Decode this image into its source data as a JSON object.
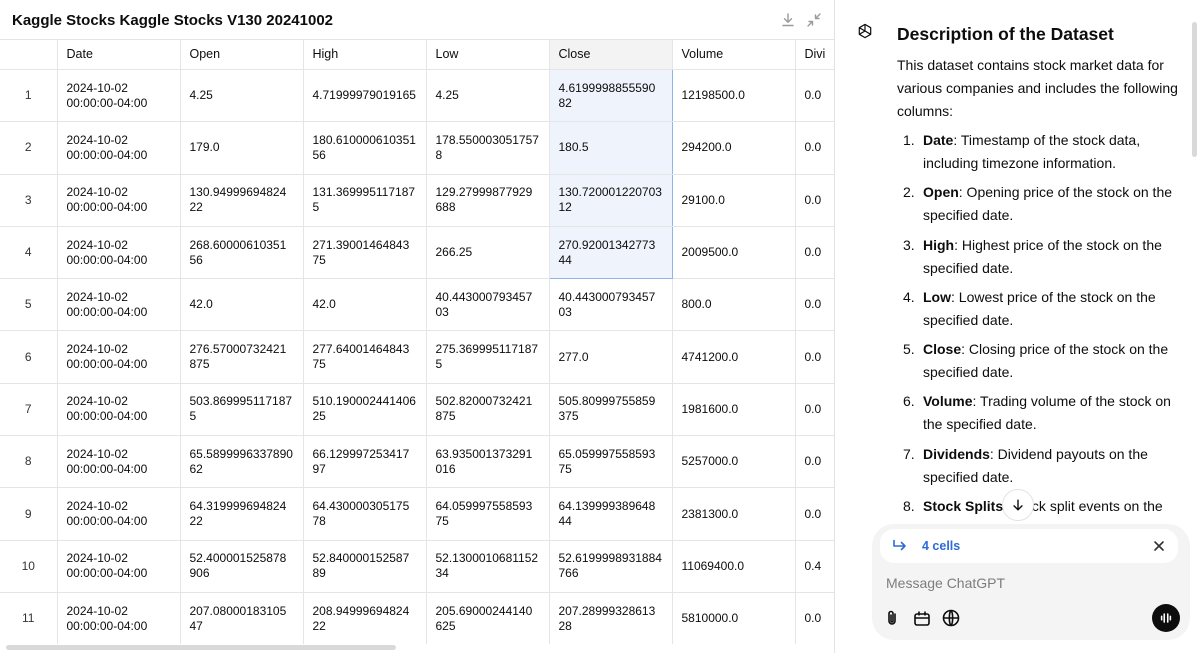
{
  "header": {
    "title": "Kaggle Stocks Kaggle Stocks V130 20241002"
  },
  "table": {
    "columns": [
      "Date",
      "Open",
      "High",
      "Low",
      "Close",
      "Volume",
      "Divi"
    ],
    "rows": [
      [
        "1",
        "2024-10-02\n00:00:00-04:00",
        "4.25",
        "4.71999979019165",
        "4.25",
        "4.6199998855590\n82",
        "12198500.0",
        "0.0"
      ],
      [
        "2",
        "2024-10-02\n00:00:00-04:00",
        "179.0",
        "180.610000610351\n56",
        "178.550003051757\n8",
        "180.5",
        "294200.0",
        "0.0"
      ],
      [
        "3",
        "2024-10-02\n00:00:00-04:00",
        "130.94999694824\n22",
        "131.369995117187\n5",
        "129.27999877929\n688",
        "130.720001220703\n12",
        "29100.0",
        "0.0"
      ],
      [
        "4",
        "2024-10-02\n00:00:00-04:00",
        "268.60000610351\n56",
        "271.39001464843\n75",
        "266.25",
        "270.92001342773\n44",
        "2009500.0",
        "0.0"
      ],
      [
        "5",
        "2024-10-02\n00:00:00-04:00",
        "42.0",
        "42.0",
        "40.443000793457\n03",
        "40.443000793457\n03",
        "800.0",
        "0.0"
      ],
      [
        "6",
        "2024-10-02\n00:00:00-04:00",
        "276.57000732421\n875",
        "277.64001464843\n75",
        "275.369995117187\n5",
        "277.0",
        "4741200.0",
        "0.0"
      ],
      [
        "7",
        "2024-10-02\n00:00:00-04:00",
        "503.869995117187\n5",
        "510.190002441406\n25",
        "502.82000732421\n875",
        "505.80999755859\n375",
        "1981600.0",
        "0.0"
      ],
      [
        "8",
        "2024-10-02\n00:00:00-04:00",
        "65.5899996337890\n62",
        "66.129997253417\n97",
        "63.935001373291\n016",
        "65.059997558593\n75",
        "5257000.0",
        "0.0"
      ],
      [
        "9",
        "2024-10-02\n00:00:00-04:00",
        "64.319999694824\n22",
        "64.430000305175\n78",
        "64.059997558593\n75",
        "64.139999389648\n44",
        "2381300.0",
        "0.0"
      ],
      [
        "10",
        "2024-10-02\n00:00:00-04:00",
        "52.400001525878\n906",
        "52.840000152587\n89",
        "52.1300010681152\n34",
        "52.6199998931884\n766",
        "11069400.0",
        "0.4"
      ],
      [
        "11",
        "2024-10-02\n00:00:00-04:00",
        "207.08000183105\n47",
        "208.94999694824\n22",
        "205.69000244140\n625",
        "207.28999328613\n28",
        "5810000.0",
        "0.0"
      ]
    ],
    "selected_column": "Close",
    "selected_rows": [
      1,
      2,
      3,
      4
    ]
  },
  "assistant": {
    "heading": "Description of the Dataset",
    "intro": "This dataset contains stock market data for various companies and includes the following columns:",
    "items": [
      {
        "num": "1.",
        "term": "Date",
        "desc": ": Timestamp of the stock data, including timezone information."
      },
      {
        "num": "2.",
        "term": "Open",
        "desc": ": Opening price of the stock on the specified date."
      },
      {
        "num": "3.",
        "term": "High",
        "desc": ": Highest price of the stock on the specified date."
      },
      {
        "num": "4.",
        "term": "Low",
        "desc": ": Lowest price of the stock on the specified date."
      },
      {
        "num": "5.",
        "term": "Close",
        "desc": ": Closing price of the stock on the specified date."
      },
      {
        "num": "6.",
        "term": "Volume",
        "desc": ": Trading volume of the stock on the specified date."
      },
      {
        "num": "7.",
        "term": "Dividends",
        "desc": ": Dividend payouts on the specified date."
      },
      {
        "num": "8.",
        "term": "Stock Splits",
        "desc": ": Stock split events on the"
      }
    ]
  },
  "composer": {
    "selection_label": "4 cells",
    "placeholder": "Message ChatGPT"
  },
  "icons": {
    "download": "download-icon",
    "collapse": "collapse-icon",
    "assistant": "openai-logo-icon",
    "scroll_down": "arrow-down-icon",
    "reply": "reply-arrow-icon",
    "close": "close-icon",
    "attach": "paperclip-icon",
    "tools": "tools-icon",
    "globe": "globe-icon",
    "voice": "voice-waveform-icon"
  },
  "colors": {
    "accent": "#2e6bd6",
    "selection_fill": "#eef3fc",
    "selection_border": "#8eb4ec"
  }
}
